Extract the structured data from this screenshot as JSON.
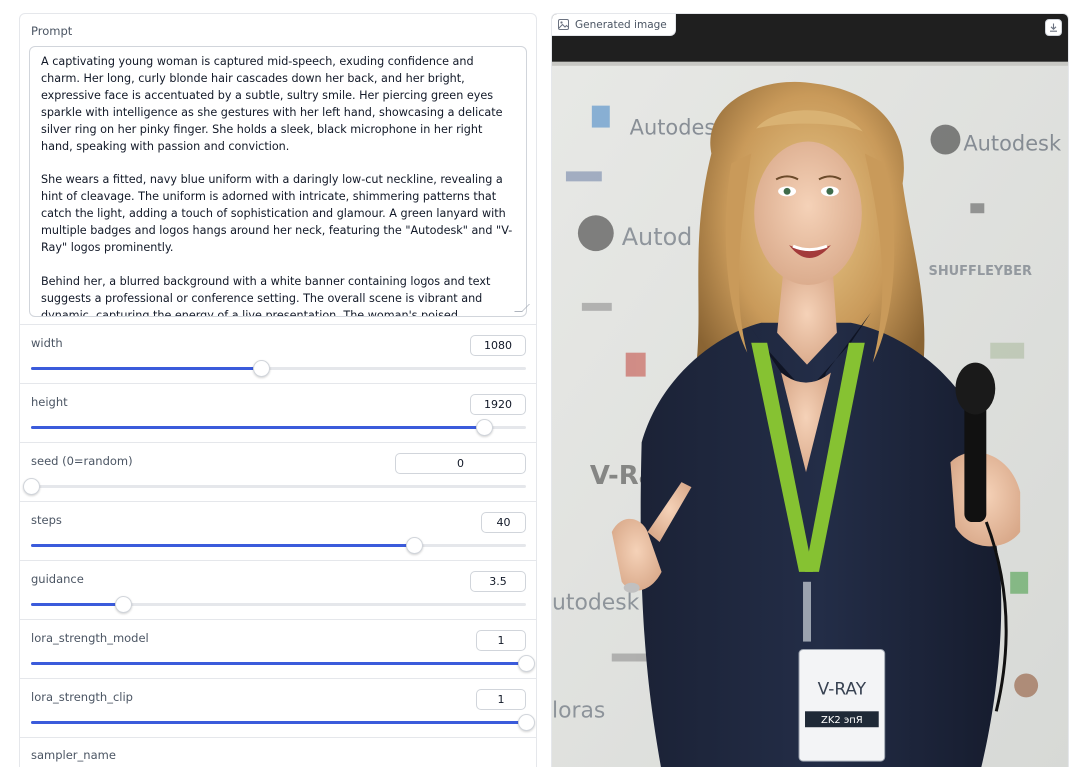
{
  "prompt": {
    "label": "Prompt",
    "text": "A captivating young woman is captured mid-speech, exuding confidence and charm. Her long, curly blonde hair cascades down her back, and her bright, expressive face is accentuated by a subtle, sultry smile. Her piercing green eyes sparkle with intelligence as she gestures with her left hand, showcasing a delicate silver ring on her pinky finger. She holds a sleek, black microphone in her right hand, speaking with passion and conviction.\n\nShe wears a fitted, navy blue uniform with a daringly low-cut neckline, revealing a hint of cleavage. The uniform is adorned with intricate, shimmering patterns that catch the light, adding a touch of sophistication and glamour. A green lanyard with multiple badges and logos hangs around her neck, featuring the \"Autodesk\" and \"V-Ray\" logos prominently.\n\nBehind her, a blurred background with a white banner containing logos and text suggests a professional or conference setting. The overall scene is vibrant and dynamic, capturing the energy of a live presentation. The woman's poised demeanor and alluring smile command attention, conveying a sense of intelligence, confidence, and subtle sensuality."
  },
  "sliders": [
    {
      "label": "width",
      "value": "1080",
      "fraction": 0.465
    },
    {
      "label": "height",
      "value": "1920",
      "fraction": 0.915
    },
    {
      "label": "seed (0=random)",
      "value": "0",
      "fraction": 0.0
    },
    {
      "label": "steps",
      "value": "40",
      "fraction": 0.773
    },
    {
      "label": "guidance",
      "value": "3.5",
      "fraction": 0.186
    },
    {
      "label": "lora_strength_model",
      "value": "1",
      "fraction": 1.0
    },
    {
      "label": "lora_strength_clip",
      "value": "1",
      "fraction": 1.0
    }
  ],
  "sampler": {
    "label": "sampler_name"
  },
  "output": {
    "label": "Generated image",
    "icons": {
      "label_icon": "image-icon",
      "download": "download-icon"
    },
    "background_logos": [
      "Autodesk",
      "Autodesk",
      "Autod",
      "V-Ray",
      "utodesk",
      "loras",
      "SHUFFLEYBER"
    ],
    "badge": {
      "brand": "V-RAY",
      "name": "ZK2 эпЯ"
    }
  },
  "colors": {
    "accent": "#3b5bdb",
    "border": "#e5e7eb",
    "label": "#4b5563"
  }
}
